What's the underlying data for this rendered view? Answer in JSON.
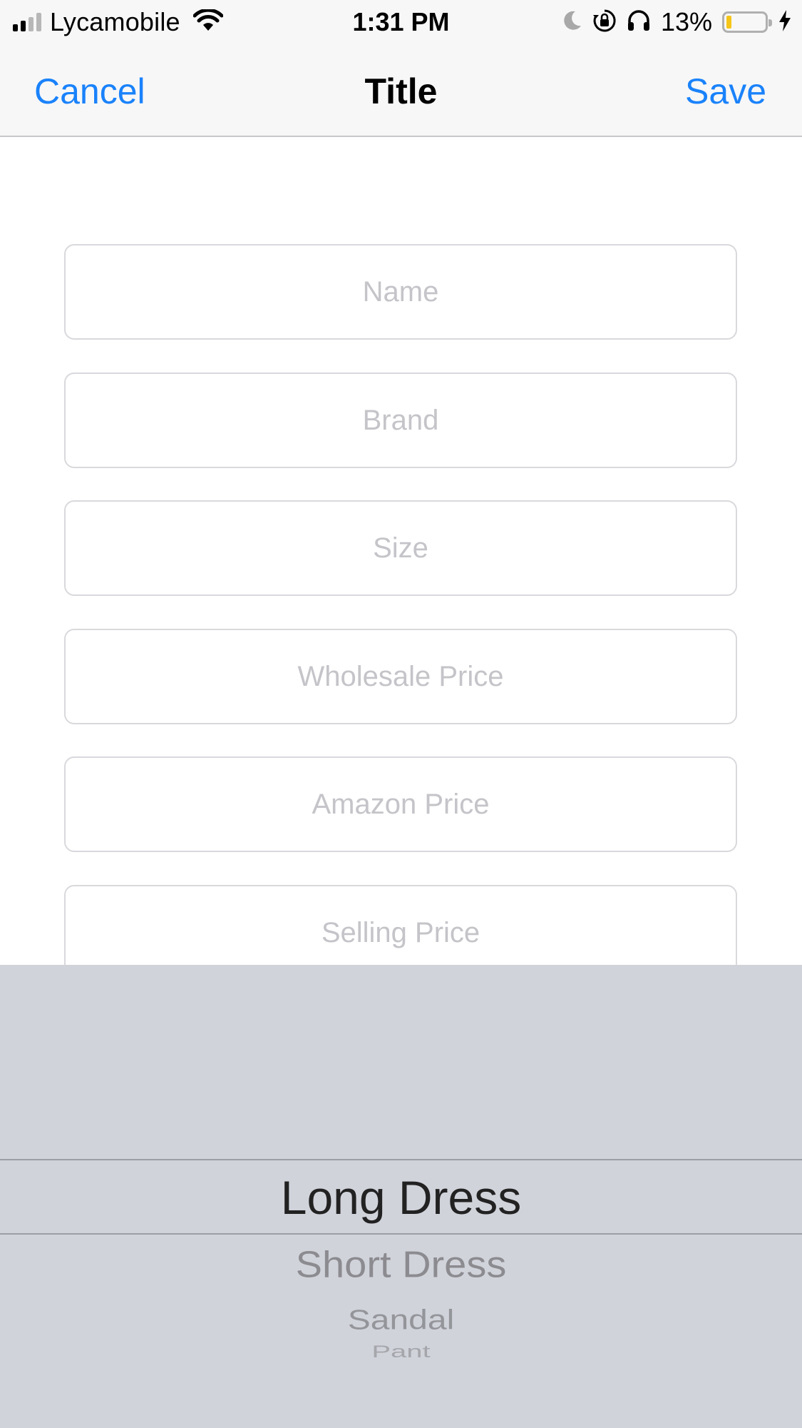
{
  "status_bar": {
    "carrier": "Lycamobile",
    "time": "1:31 PM",
    "battery_percent": "13%",
    "battery_level": 0.13,
    "battery_color": "#f5c518",
    "icons": [
      "signal-icon",
      "wifi-icon",
      "moon-icon",
      "rotation-lock-icon",
      "headphones-icon",
      "battery-icon",
      "charging-bolt-icon"
    ]
  },
  "nav_bar": {
    "cancel_label": "Cancel",
    "title": "Title",
    "save_label": "Save",
    "accent_color": "#1a82fb"
  },
  "form": {
    "fields": [
      {
        "placeholder": "Name",
        "value": ""
      },
      {
        "placeholder": "Brand",
        "value": ""
      },
      {
        "placeholder": "Size",
        "value": ""
      },
      {
        "placeholder": "Wholesale Price",
        "value": ""
      },
      {
        "placeholder": "Amazon Price",
        "value": ""
      },
      {
        "placeholder": "Selling Price",
        "value": ""
      }
    ]
  },
  "picker": {
    "selected": "Long Dress",
    "items": [
      "Long Dress",
      "Short Dress",
      "Sandal",
      "Pant"
    ],
    "background_color": "#d1d3db"
  }
}
